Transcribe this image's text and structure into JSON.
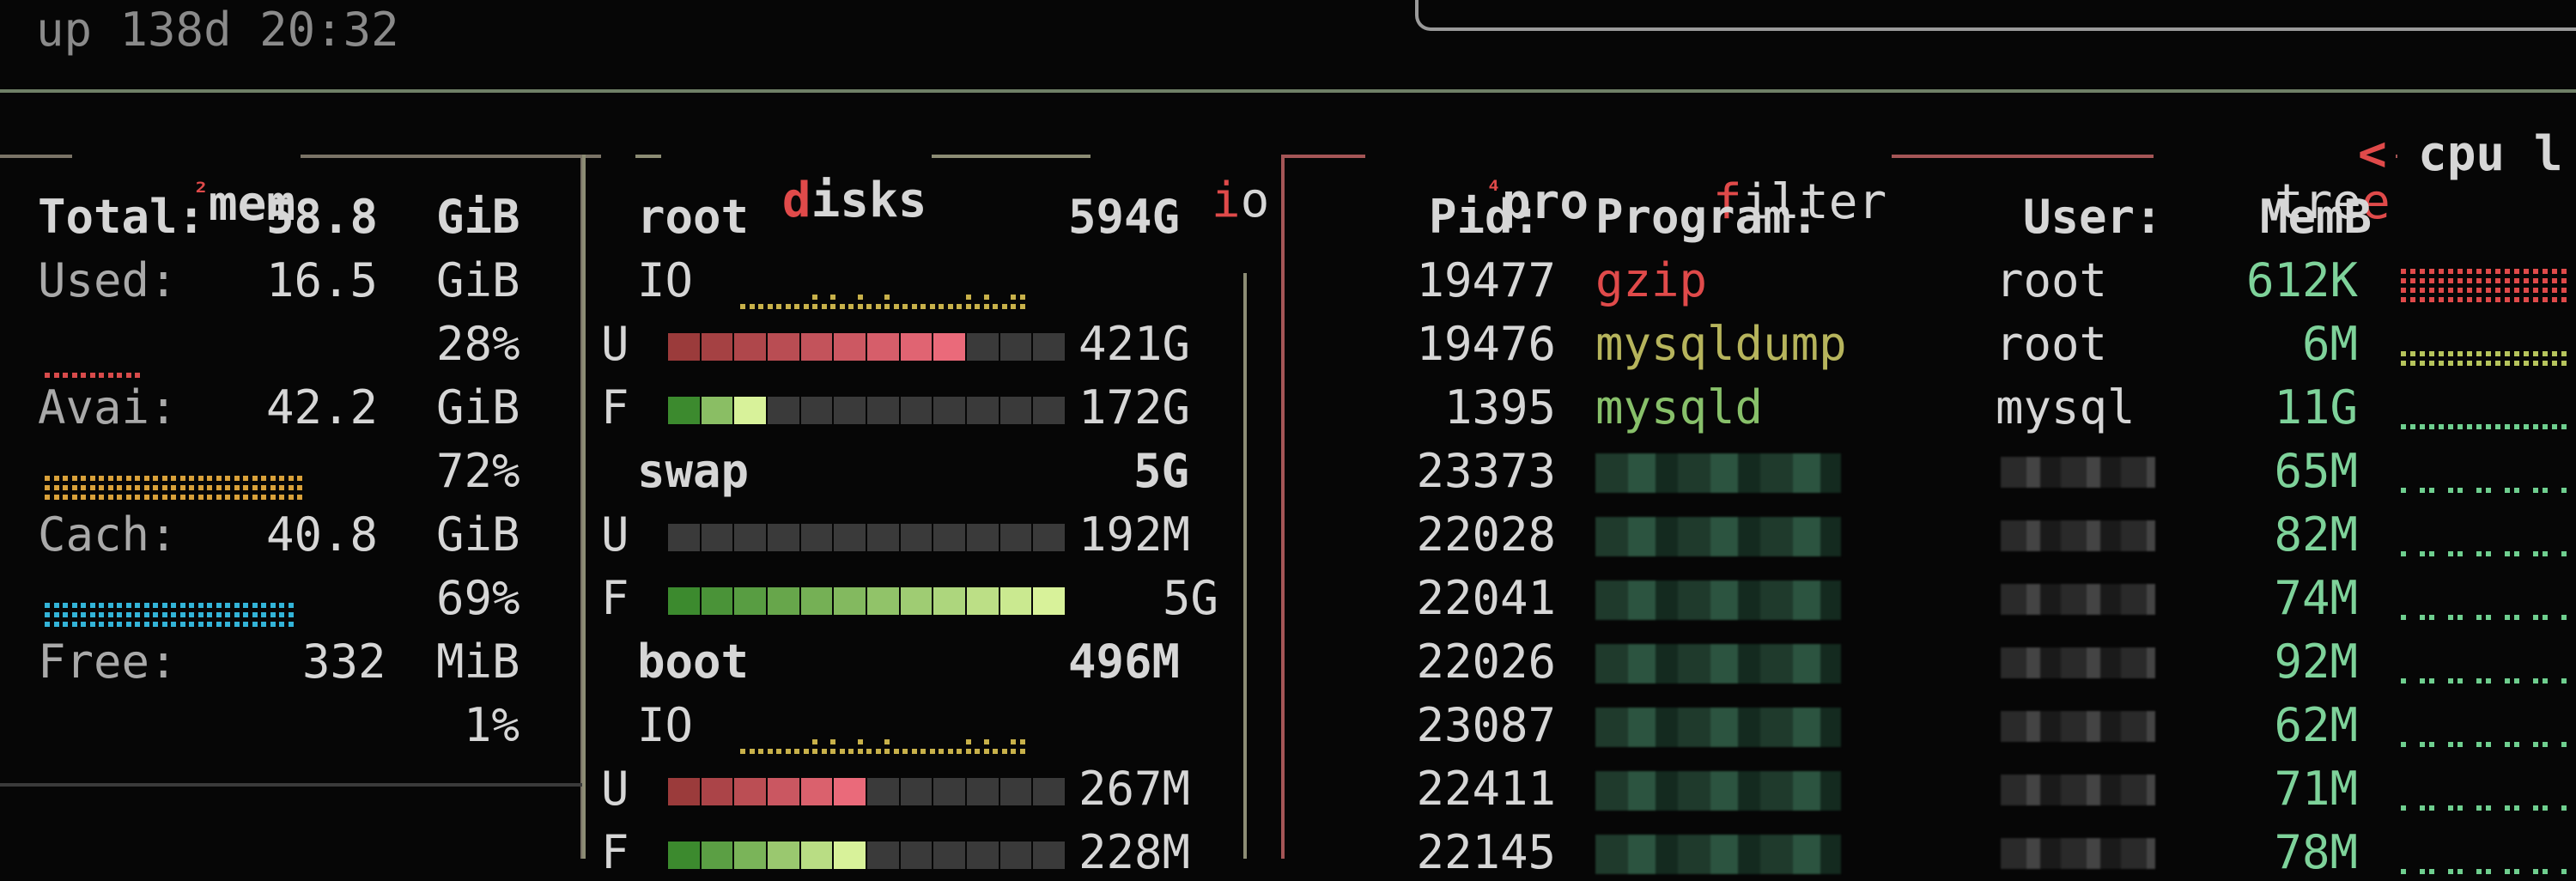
{
  "header": {
    "uptime": "up 138d 20:32"
  },
  "mem": {
    "superscript": "²",
    "title": "mem",
    "rows": [
      {
        "label": "Total:",
        "value": "58.8",
        "unit": "GiB"
      },
      {
        "label": "Used:",
        "value": "16.5",
        "unit": "GiB",
        "percent": "28%",
        "fill": 0.28
      },
      {
        "label": "Avai:",
        "value": "42.2",
        "unit": "GiB",
        "percent": "72%",
        "fill": 0.72
      },
      {
        "label": "Cach:",
        "value": "40.8",
        "unit": "GiB",
        "percent": "69%",
        "fill": 0.69
      },
      {
        "label": "Free:",
        "value": "332",
        "unit": "MiB",
        "percent": "1%",
        "fill": 0.01
      }
    ]
  },
  "disks": {
    "title_first": "d",
    "title_rest": "isks",
    "io_label_first": "i",
    "io_label_rest": "o",
    "root": {
      "name": "root",
      "size": "594G",
      "io": "IO",
      "used_label": "U",
      "used": "421G",
      "used_fill": 0.71,
      "free_label": "F",
      "free": "172G",
      "free_fill": 0.29
    },
    "swap": {
      "name": "swap",
      "size": "5G",
      "used_label": "U",
      "used": "192M",
      "used_fill": 0.04,
      "free_label": "F",
      "free": "5G",
      "free_fill": 0.96
    },
    "boot": {
      "name": "boot",
      "size": "496M",
      "io": "IO",
      "used_label": "U",
      "used": "267M",
      "used_fill": 0.54,
      "free_label": "F",
      "free": "228M",
      "free_fill": 0.46
    }
  },
  "proc": {
    "superscript": "⁴",
    "title": "proc",
    "filter_first": "f",
    "filter_rest": "ilter",
    "tree_a": "tre",
    "tree_b": "e",
    "arrow": "<",
    "cpu_label": "cpu l",
    "columns": {
      "pid": "Pid:",
      "program": "Program:",
      "user": "User:",
      "memb": "MemB"
    },
    "rows": [
      {
        "pid": "19477",
        "program": "gzip",
        "user": "root",
        "memb": "612K",
        "cpu": 0.9
      },
      {
        "pid": "19476",
        "program": "mysqldump",
        "user": "root",
        "memb": "6M",
        "cpu": 0.5
      },
      {
        "pid": "1395",
        "program": "mysqld",
        "user": "mysql",
        "memb": "11G",
        "cpu": 0.3
      },
      {
        "pid": "23373",
        "program": "",
        "user": "",
        "memb": "65M",
        "cpu": 0.2
      },
      {
        "pid": "22028",
        "program": "",
        "user": "",
        "memb": "82M",
        "cpu": 0.2
      },
      {
        "pid": "22041",
        "program": "",
        "user": "",
        "memb": "74M",
        "cpu": 0.2
      },
      {
        "pid": "22026",
        "program": "",
        "user": "",
        "memb": "92M",
        "cpu": 0.2
      },
      {
        "pid": "23087",
        "program": "",
        "user": "",
        "memb": "62M",
        "cpu": 0.2
      },
      {
        "pid": "22411",
        "program": "",
        "user": "",
        "memb": "71M",
        "cpu": 0.2
      },
      {
        "pid": "22145",
        "program": "",
        "user": "",
        "memb": "78M",
        "cpu": 0.2
      }
    ]
  },
  "colors": {
    "gzip": "#e04a4a",
    "mysqldump": "#b6b45c",
    "mysqld": "#88c06a",
    "memb": "#7ed29a",
    "mem_used": "#d84b4b",
    "mem_avail": "#d9a13a",
    "mem_cache": "#33b4d8",
    "disk_used_from": "#9b3b3b",
    "disk_used_to": "#ea6a7a",
    "disk_free_from": "#3c8a2e",
    "disk_free_to": "#d8f29a",
    "bar_empty": "#3a3a3a"
  }
}
